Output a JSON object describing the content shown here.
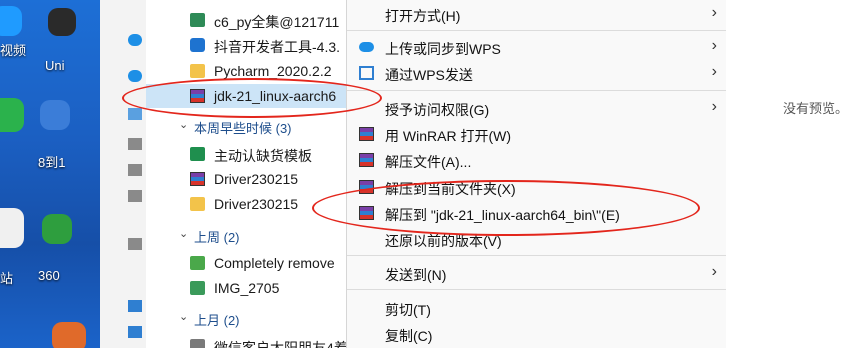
{
  "desktop": {
    "labels": [
      "视频",
      "Uni",
      "8到1",
      "360",
      "站"
    ]
  },
  "file_list": {
    "top_items": [
      {
        "label": "c6_py全集@121711",
        "icon": "doc-icon"
      },
      {
        "label": "抖音开发者工具-4.3.",
        "icon": "app-icon"
      },
      {
        "label": "Pycharm_2020.2.2",
        "icon": "folder-icon"
      },
      {
        "label": "jdk-21_linux-aarch6",
        "icon": "winrar-archive-icon",
        "selected": true
      }
    ],
    "group_this_week_early": "本周早些时候 (3)",
    "this_week_items": [
      {
        "label": "主动认缺货模板",
        "icon": "spreadsheet-icon"
      },
      {
        "label": "Driver230215",
        "icon": "winrar-archive-icon"
      },
      {
        "label": "Driver230215",
        "icon": "folder-icon"
      }
    ],
    "group_last_week": "上周 (2)",
    "last_week_items": [
      {
        "label": "Completely remove",
        "icon": "video-icon"
      },
      {
        "label": "IMG_2705",
        "icon": "image-icon"
      }
    ],
    "group_last_month": "上月 (2)",
    "last_month_item": "微信客户太阳朋友4着"
  },
  "context_menu": {
    "items": [
      {
        "label": "打开方式(H)",
        "submenu": true
      },
      {
        "label": "上传或同步到WPS",
        "submenu": true,
        "icon": "cloud-icon"
      },
      {
        "label": "通过WPS发送",
        "submenu": true,
        "icon": "share-icon"
      },
      {
        "label": "授予访问权限(G)",
        "submenu": true
      },
      {
        "label": "用 WinRAR 打开(W)",
        "icon": "winrar-icon"
      },
      {
        "label": "解压文件(A)...",
        "icon": "winrar-icon"
      },
      {
        "label": "解压到当前文件夹(X)",
        "icon": "winrar-icon"
      },
      {
        "label": "解压到 \"jdk-21_linux-aarch64_bin\\\"(E)",
        "icon": "winrar-icon"
      },
      {
        "label": "还原以前的版本(V)"
      },
      {
        "label": "发送到(N)",
        "submenu": true
      },
      {
        "label": "剪切(T)"
      },
      {
        "label": "复制(C)"
      }
    ]
  },
  "preview": {
    "text": "没有预览。"
  },
  "colors": {
    "annotation": "#e3261c",
    "selection": "#cce4f7",
    "desktop_bg": "#1b5fc2"
  }
}
